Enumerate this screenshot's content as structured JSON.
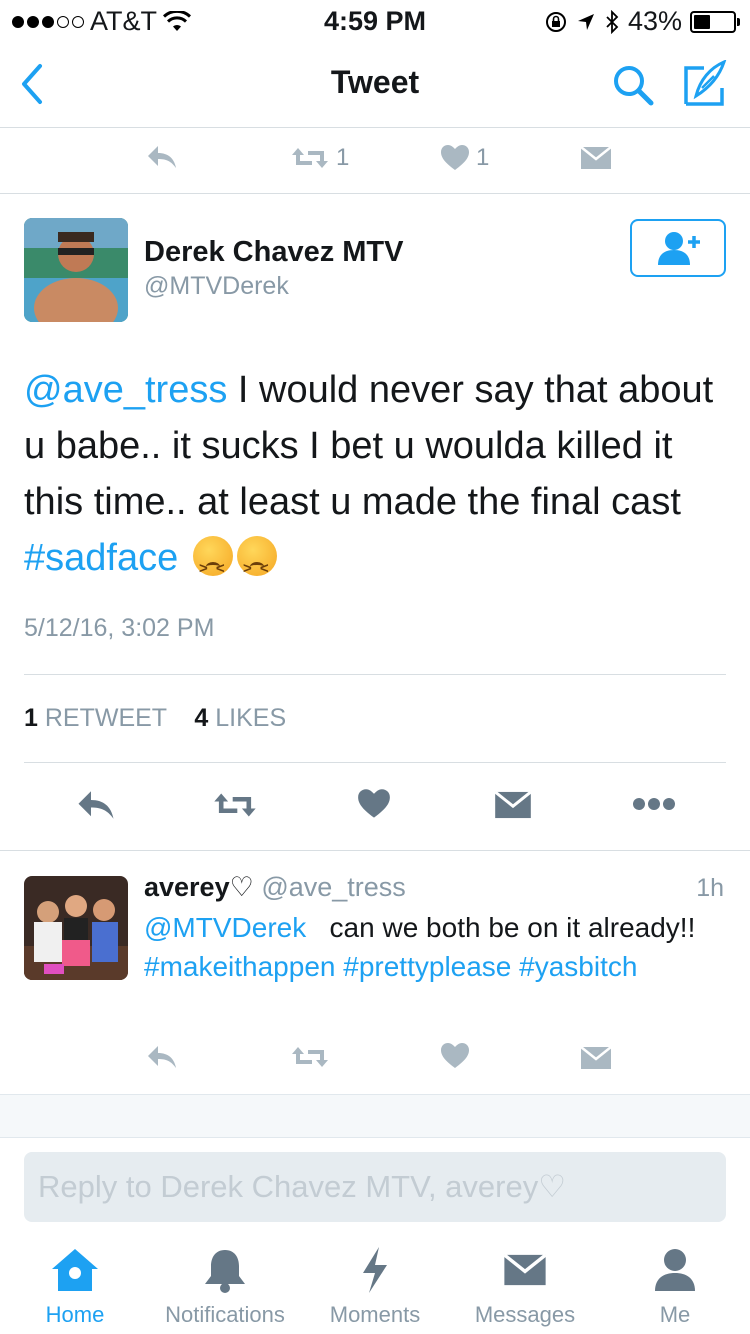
{
  "status_bar": {
    "carrier": "AT&T",
    "time": "4:59 PM",
    "battery": "43%",
    "battery_level": 0.43,
    "signal_icon": "signal-dots-icon",
    "wifi_icon": "wifi-icon"
  },
  "nav": {
    "title": "Tweet",
    "back_icon": "chevron-left-icon",
    "search_icon": "search-icon",
    "compose_icon": "compose-icon"
  },
  "top_actions": {
    "retweet_count": "1",
    "like_count": "1"
  },
  "tweet": {
    "author_name": "Derek Chavez MTV",
    "author_handle": "@MTVDerek",
    "mention": "@ave_tress",
    "text_main": " I would never say that about u babe.. it sucks I bet u woulda killed it this time.. at least u made the final cast ",
    "hashtag": "#sadface",
    "emoji": "persevering-face-emoji",
    "timestamp": "5/12/16, 3:02 PM",
    "retweets_count": "1",
    "retweets_label": "RETWEET",
    "likes_count": "4",
    "likes_label": "LIKES"
  },
  "reply": {
    "name": "averey♡",
    "handle": "@ave_tress",
    "time": "1h",
    "mention": "@MTVDerek",
    "text_a": "   can we both be on it already!! ",
    "hashtag_1": "#makeithappen",
    "hashtag_2": "#prettyplease",
    "hashtag_3": "#yasbitch"
  },
  "composer": {
    "placeholder": "Reply to Derek Chavez MTV, averey♡"
  },
  "tabs": [
    {
      "label": "Home",
      "icon": "home-icon",
      "active": true
    },
    {
      "label": "Notifications",
      "icon": "bell-icon",
      "active": false
    },
    {
      "label": "Moments",
      "icon": "lightning-icon",
      "active": false
    },
    {
      "label": "Messages",
      "icon": "envelope-icon",
      "active": false
    },
    {
      "label": "Me",
      "icon": "person-icon",
      "active": false
    }
  ],
  "colors": {
    "accent": "#1da1f2",
    "grey_icon": "#aab8c2",
    "dark_icon": "#657786",
    "separator": "#d8dee2"
  }
}
